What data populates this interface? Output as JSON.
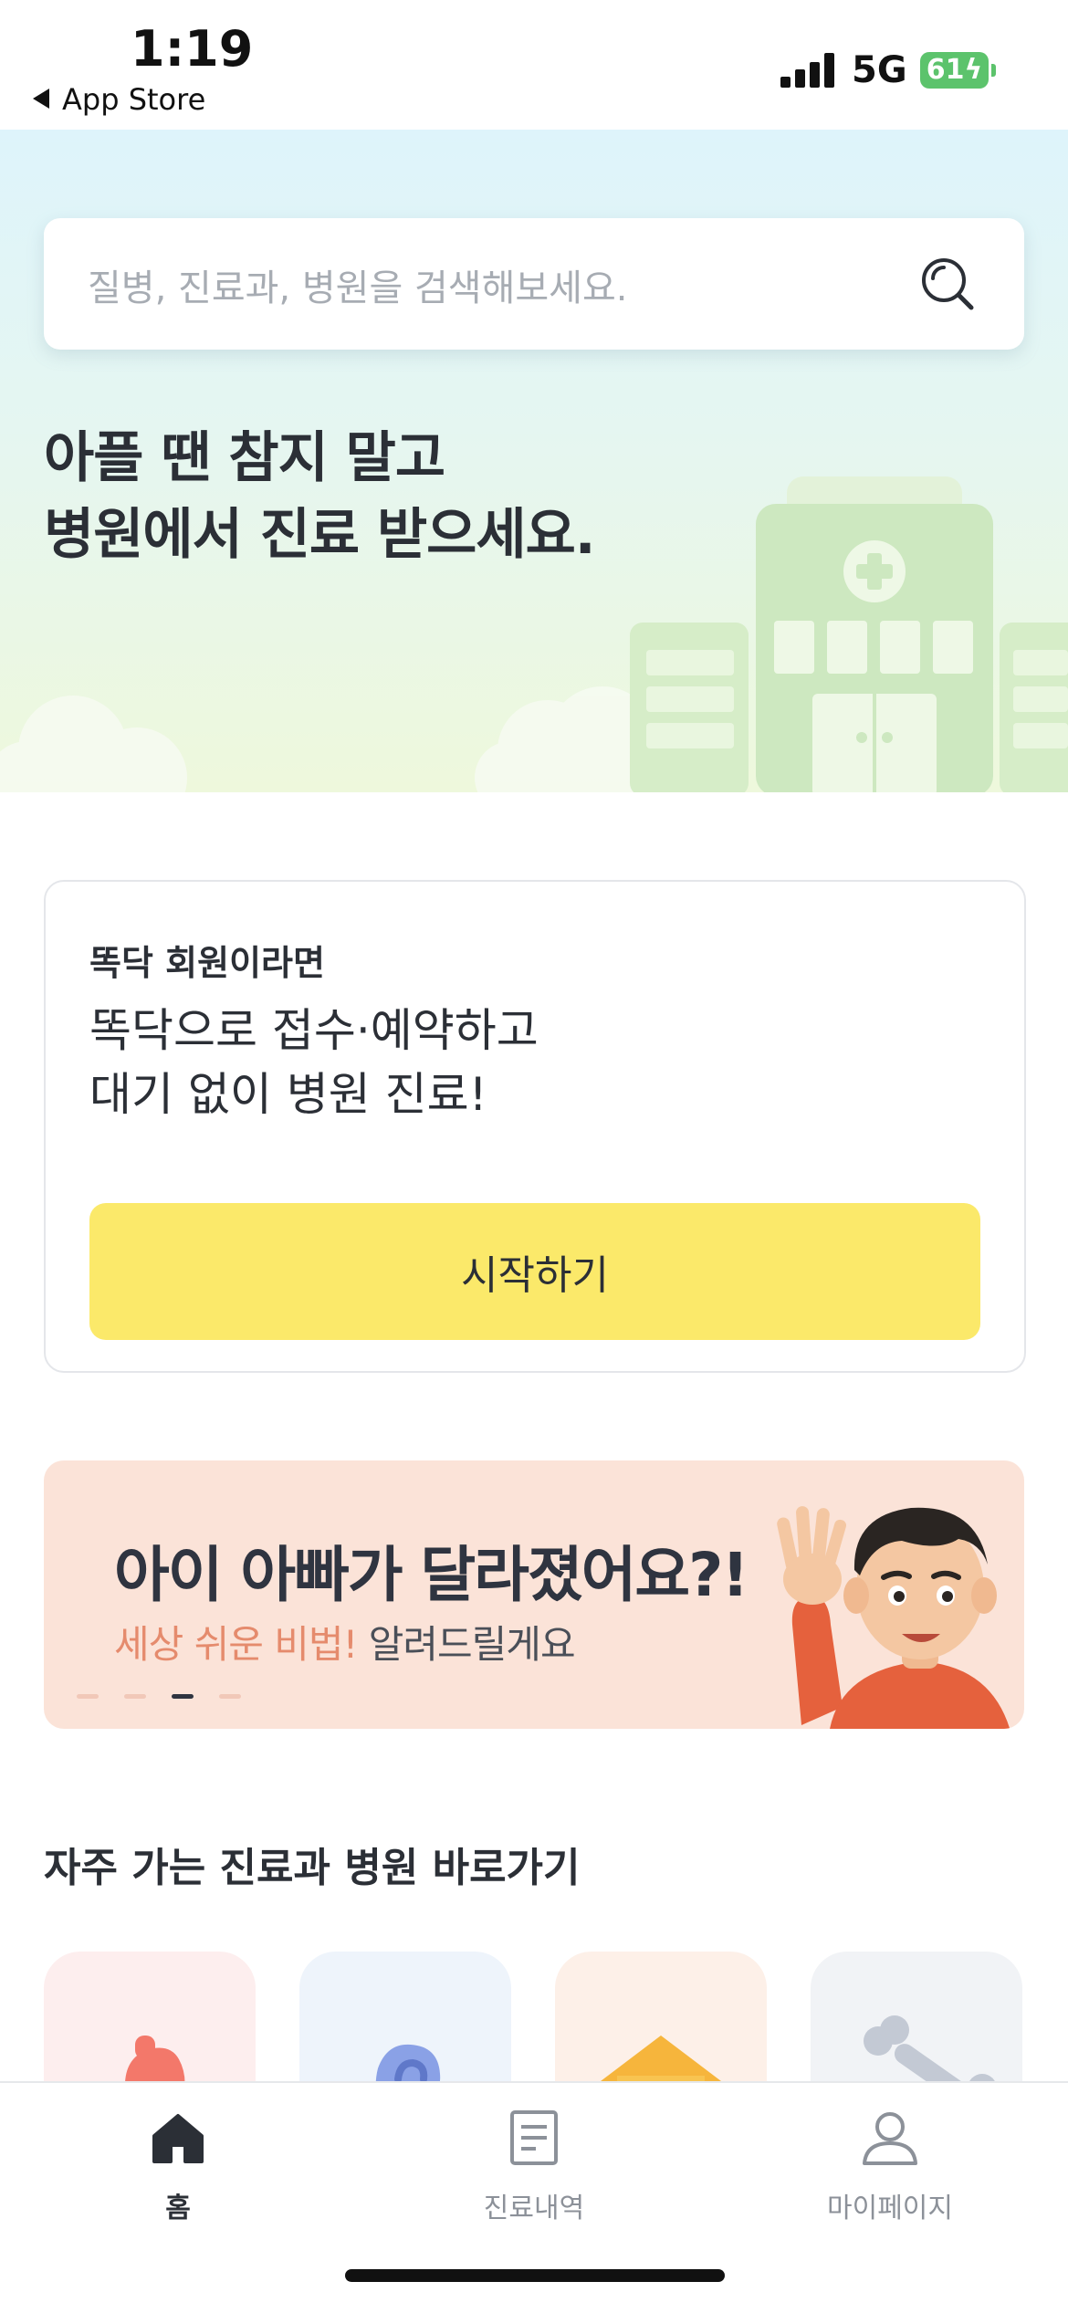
{
  "status_bar": {
    "time": "1:19",
    "back_label": "App Store",
    "network": "5G",
    "battery": "61"
  },
  "search": {
    "placeholder": "질병, 진료과, 병원을 검색해보세요."
  },
  "hero": {
    "title": "아플 땐 참지 말고\n병원에서 진료 받으세요."
  },
  "member_card": {
    "subtitle": "똑닥 회원이라면",
    "body": "똑닥으로 접수·예약하고\n대기 없이 병원 진료!",
    "button_label": "시작하기"
  },
  "banner": {
    "title": "아이 아빠가 달라졌어요?!",
    "subtitle_accent": "세상 쉬운 비법!",
    "subtitle_rest": " 알려드릴게요",
    "active_page": 3,
    "page_count": 4
  },
  "shortcuts": {
    "title": "자주 가는 진료과 병원 바로가기",
    "items": [
      {
        "icon": "stomach-icon",
        "bg": "#fdeeee"
      },
      {
        "icon": "ear-icon",
        "bg": "#eef4fb"
      },
      {
        "icon": "hospital-house-icon",
        "bg": "#fdf0e8"
      },
      {
        "icon": "bone-icon",
        "bg": "#f1f3f6"
      }
    ]
  },
  "tab_bar": {
    "tabs": [
      {
        "label": "홈",
        "icon": "home-icon",
        "active": true
      },
      {
        "label": "진료내역",
        "icon": "document-icon",
        "active": false
      },
      {
        "label": "마이페이지",
        "icon": "person-icon",
        "active": false
      }
    ]
  },
  "colors": {
    "accent_yellow": "#fbe96a",
    "banner_bg": "#fbe3d8",
    "banner_accent": "#e58b6d",
    "battery_green": "#5cc36c"
  }
}
